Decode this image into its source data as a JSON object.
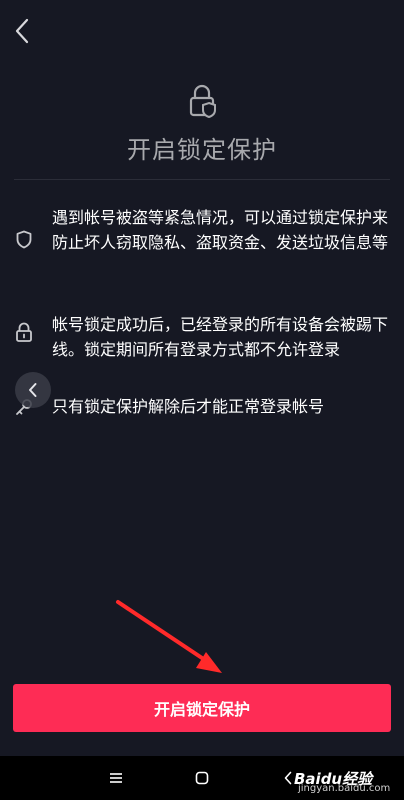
{
  "page": {
    "title": "开启锁定保护"
  },
  "features": [
    {
      "icon": "shield-icon",
      "text": "遇到帐号被盗等紧急情况，可以通过锁定保护来防止坏人窃取隐私、盗取资金、发送垃圾信息等"
    },
    {
      "icon": "lock-icon",
      "text": "帐号锁定成功后，已经登录的所有设备会被踢下线。锁定期间所有登录方式都不允许登录"
    },
    {
      "icon": "key-icon",
      "text": "只有锁定保护解除后才能正常登录帐号"
    }
  ],
  "cta": {
    "label": "开启锁定保护"
  },
  "watermark": {
    "logo": "Baidu经验",
    "sub": "jingyan.baidu.com"
  },
  "colors": {
    "background": "#161823",
    "accent": "#fe2c55",
    "annotation": "#ff2a2a"
  }
}
